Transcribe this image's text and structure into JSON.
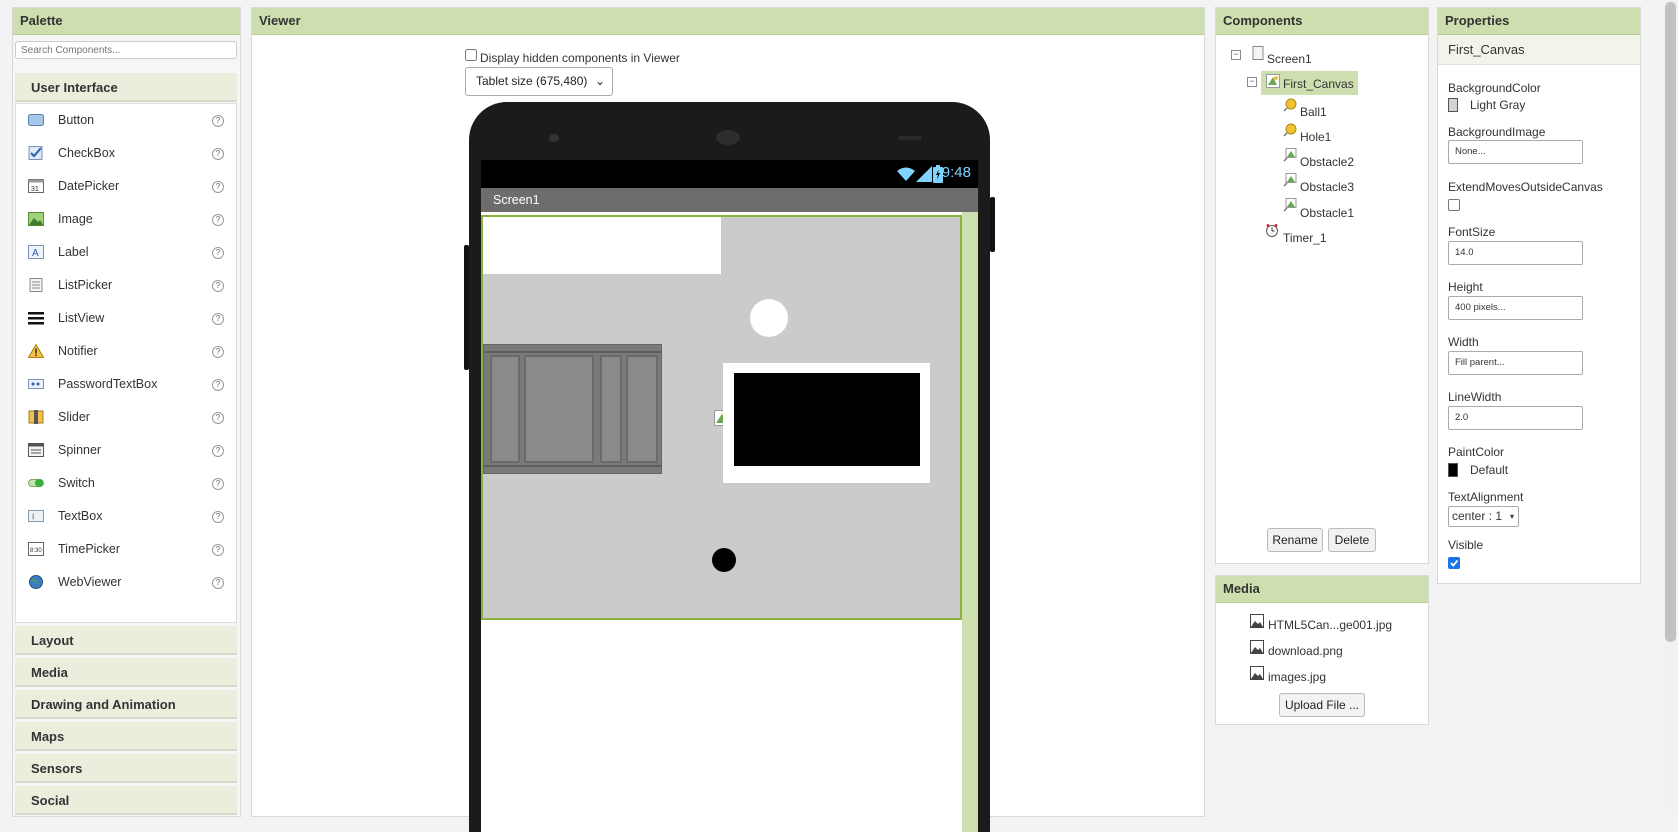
{
  "palette": {
    "title": "Palette",
    "search_placeholder": "Search Components...",
    "open_category": "User Interface",
    "items": [
      {
        "label": "Button",
        "icon": "button-icon"
      },
      {
        "label": "CheckBox",
        "icon": "checkbox-icon"
      },
      {
        "label": "DatePicker",
        "icon": "datepicker-icon"
      },
      {
        "label": "Image",
        "icon": "image-icon"
      },
      {
        "label": "Label",
        "icon": "label-icon"
      },
      {
        "label": "ListPicker",
        "icon": "listpicker-icon"
      },
      {
        "label": "ListView",
        "icon": "listview-icon"
      },
      {
        "label": "Notifier",
        "icon": "notifier-icon"
      },
      {
        "label": "PasswordTextBox",
        "icon": "passwordtextbox-icon"
      },
      {
        "label": "Slider",
        "icon": "slider-icon"
      },
      {
        "label": "Spinner",
        "icon": "spinner-icon"
      },
      {
        "label": "Switch",
        "icon": "switch-icon"
      },
      {
        "label": "TextBox",
        "icon": "textbox-icon"
      },
      {
        "label": "TimePicker",
        "icon": "timepicker-icon"
      },
      {
        "label": "WebViewer",
        "icon": "webviewer-icon"
      }
    ],
    "help_glyph": "?",
    "categories": [
      "Layout",
      "Media",
      "Drawing and Animation",
      "Maps",
      "Sensors",
      "Social"
    ]
  },
  "viewer": {
    "title": "Viewer",
    "display_hidden_label": "Display hidden components in Viewer",
    "display_hidden_checked": false,
    "size_select": "Tablet size (675,480)",
    "status_time": "9:48",
    "screen_title": "Screen1"
  },
  "components": {
    "title": "Components",
    "tree": {
      "screen": "Screen1",
      "canvas": "First_Canvas",
      "canvas_children": [
        "Ball1",
        "Hole1",
        "Obstacle2",
        "Obstacle3",
        "Obstacle1"
      ],
      "timer": "Timer_1"
    },
    "rename_label": "Rename",
    "delete_label": "Delete"
  },
  "media": {
    "title": "Media",
    "files": [
      "HTML5Can...ge001.jpg",
      "download.png",
      "images.jpg"
    ],
    "upload_label": "Upload File ..."
  },
  "properties": {
    "title": "Properties",
    "component": "First_Canvas",
    "background_color_label": "BackgroundColor",
    "background_color_value": "Light Gray",
    "background_image_label": "BackgroundImage",
    "background_image_value": "None...",
    "extend_label": "ExtendMovesOutsideCanvas",
    "extend_checked": false,
    "font_size_label": "FontSize",
    "font_size_value": "14.0",
    "height_label": "Height",
    "height_value": "400 pixels...",
    "width_label": "Width",
    "width_value": "Fill parent...",
    "line_width_label": "LineWidth",
    "line_width_value": "2.0",
    "paint_color_label": "PaintColor",
    "paint_color_value": "Default",
    "text_alignment_label": "TextAlignment",
    "text_alignment_value": "center : 1",
    "visible_label": "Visible",
    "visible_checked": true
  },
  "colors": {
    "header_bg": "#cddfae",
    "selected_bg": "#cddfae",
    "canvas_bg": "#cbcbcb",
    "canvas_border": "#8bb23a",
    "checkbox_accent": "#1a73e8"
  }
}
